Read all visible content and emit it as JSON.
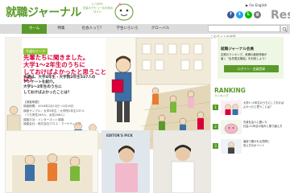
{
  "site": {
    "logo": "就職ジャーナル",
    "tagline": [
      "いつかの",
      "社会人デビューのための",
      "サイト"
    ],
    "english_link": "▶ For English",
    "right_edge_logo": "Res"
  },
  "social": [
    {
      "name": "facebook",
      "glyph": "f",
      "color": "#3b5998"
    },
    {
      "name": "twitter",
      "glyph": "t",
      "color": "#1da1f2"
    },
    {
      "name": "line",
      "glyph": "L",
      "color": "#00b900"
    },
    {
      "name": "googleplus",
      "glyph": "g",
      "color": "#7a7a7a"
    }
  ],
  "nav": {
    "items": [
      {
        "label": "ホーム",
        "active": true
      },
      {
        "label": "特集"
      },
      {
        "label": "社会人って?"
      },
      {
        "label": "学生いろいろ"
      },
      {
        "label": "グローバル"
      }
    ],
    "search_placeholder": "このサイトを検索"
  },
  "hero": {
    "tag": "今週のテーマ",
    "title": [
      "先輩たちに聞きました。",
      "大学1～2年生のうちに",
      "しておけばよかったと思うことは？"
    ],
    "lead": [
      "今週は、大学4年生・大学院2年生537人の",
      "アンケートを紹介。",
      "大学1～2年生のうちに",
      "しておけばよかったことは？"
    ],
    "meta": [
      "【調査概要】",
      "調査期間：2016年2月13日～2月16日",
      "調査サンプル：大学4年生・大学院2年生537人",
      "（うち男性269人、女性268人）",
      "調査方法：インターネット調査",
      "調査会社：株式会社クロス・マーケティング"
    ]
  },
  "member": {
    "title": "就職ジャーナル会員",
    "text": [
      "定期のランキング、就職の最新情報が",
      "届く「会員限定機能」を利用しよう！"
    ],
    "login_label": "ログイン・会員登録"
  },
  "ranking": {
    "heading": "RANKING",
    "subtitle": "ランキング",
    "items": [
      {
        "rank": "1",
        "lines": [
          "大学1～2年生のうちにしておけば",
          "よかったと思うことは？"
        ]
      },
      {
        "rank": "2",
        "lines": [
          "先輩社会人に聞いた",
          "社会人1年目の悩みと乗り越え方"
        ]
      },
      {
        "rank": "3",
        "lines": [
          "面接で聞かれる質問と",
          "答え方のポイント"
        ]
      }
    ]
  },
  "cards": {
    "editor_label": "EDITOR'S PICK"
  },
  "colors": {
    "brand_green": "#5a9a2a",
    "headline_red": "#d9003b",
    "nav_gray": "#dcdcdc"
  }
}
